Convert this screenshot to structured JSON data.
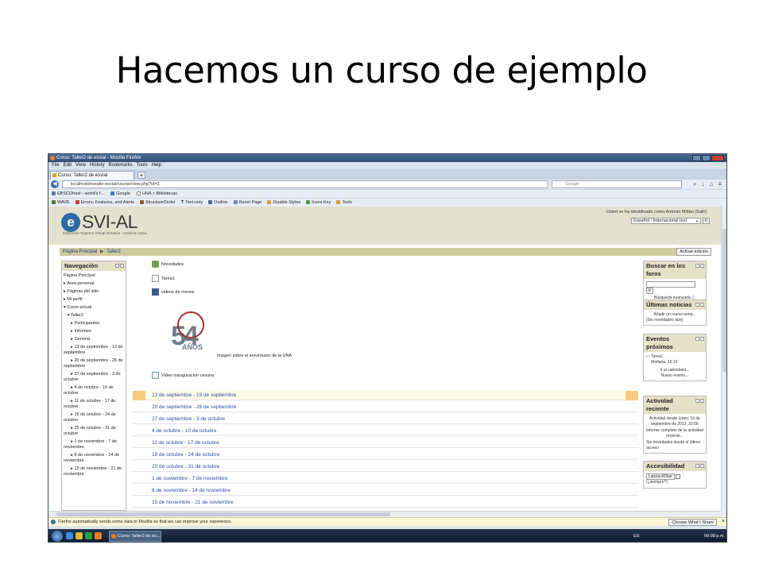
{
  "slide": {
    "title": "Hacemos un curso de ejemplo"
  },
  "window": {
    "title": "Curso: Taller2 de esvial - Mozilla Firefox",
    "menu": [
      "File",
      "Edit",
      "View",
      "History",
      "Bookmarks",
      "Tools",
      "Help"
    ],
    "tab_label": "Curso: Taller2 de esvial",
    "new_tab": "+",
    "url": "localhost/moodle-esvial/course/view.php?id=2",
    "search_placeholder": "Google",
    "bookmarks": [
      "EBSCOhost - world's f...",
      "Google",
      "UNA > Bibliotecas"
    ],
    "wave_toolbar": [
      "WAVE",
      "Errors, Features, and Alerts",
      "Structure/Order",
      "Text-only",
      "Outline",
      "Reset Page",
      "Disable Styles",
      "Icons Key",
      "Tools"
    ]
  },
  "header": {
    "logo_letter": "e",
    "logo_text": "SVI-AL",
    "logo_sub": "Educación Superior Virtual Inclusiva - América Latina",
    "login_info": "Usted se ha identificado como Antonio Miñán (Salir)",
    "language": "Español - Internacional (es)",
    "go_label": "Ir"
  },
  "breadcrumb": {
    "home": "Página Principal",
    "sep": "▶",
    "course": "Taller2",
    "edit_button": "Activar edición"
  },
  "navigation": {
    "title": "Navegación",
    "items": [
      "Página Principal",
      "▸ Área personal",
      "▸ Páginas del sitio",
      "▸ Mi perfil",
      "▾ Curso actual",
      "   ▾ Taller2",
      "      ▸ Participantes",
      "      ▸ Informes",
      "      ▸ General",
      "      ▸ 13 de septiembre - 19 de septiembre",
      "      ▸ 20 de septiembre - 26 de septiembre",
      "      ▸ 27 de septiembre - 3 de octubre",
      "      ▸ 4 de octubre - 10 de octubre",
      "      ▸ 11 de octubre - 17 de octubre",
      "      ▸ 18 de octubre - 24 de octubre",
      "      ▸ 25 de octubre - 31 de octubre",
      "      ▸ 1 de noviembre - 7 de noviembre",
      "      ▸ 8 de noviembre - 14 de noviembre",
      "      ▸ 15 de noviembre - 21 de noviembre"
    ]
  },
  "content": {
    "resources": [
      "Novedades",
      "Tarea1",
      "videos de monos"
    ],
    "image_caption": "imagen sobre el aniversario de la UNA",
    "seal_number": "54",
    "seal_word": "AÑOS",
    "video": "Video inauguracion cevuna",
    "weeks": [
      "13 de septiembre - 19 de septiembre",
      "20 de septiembre - 26 de septiembre",
      "27 de septiembre - 3 de octubre",
      "4 de octubre - 10 de octubre",
      "11 de octubre - 17 de octubre",
      "18 de octubre - 24 de octubre",
      "25 de octubre - 31 de octubre",
      "1 de noviembre - 7 de noviembre",
      "8 de noviembre - 14 de noviembre",
      "15 de noviembre - 21 de noviembre"
    ]
  },
  "blocks": {
    "search": {
      "title": "Buscar en los foros",
      "go": "Ir",
      "advanced": "Búsqueda avanzada"
    },
    "news": {
      "title": "Últimas noticias",
      "add": "Añadir un nuevo tema...",
      "empty": "(Sin novedades aún)"
    },
    "events": {
      "title": "Eventos próximos",
      "item": "Tarea1",
      "when": "Mañana, 15:10",
      "calendar": "Ir al calendario...",
      "new_event": "Nuevo evento..."
    },
    "activity": {
      "title": "Actividad reciente",
      "since": "Actividad desde lunes, 16 de septiembre de 2013, 22:06",
      "report": "Informe completo de la actividad reciente...",
      "none": "Sin novedades desde el último acceso"
    },
    "accessibility": {
      "title": "Accesibilidad",
      "button": "Lanzar ATbar",
      "always": "(¿siempre?)"
    }
  },
  "notification": {
    "text": "Firefox automatically sends some data to Mozilla so that we can improve your experience.",
    "button": "Choose What I Share",
    "close": "×"
  },
  "taskbar": {
    "task": "Curso: Taller2 de es...",
    "locale": "ES",
    "clock": "06:08 p.m."
  }
}
